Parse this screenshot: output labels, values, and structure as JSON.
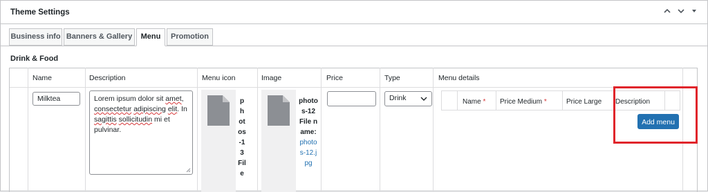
{
  "panel": {
    "title": "Theme Settings",
    "controls": [
      "chevron-up-icon",
      "chevron-down-icon",
      "caret-down-icon"
    ]
  },
  "tabs": [
    {
      "label": "Business info",
      "active": false
    },
    {
      "label": "Banners & Gallery",
      "active": false
    },
    {
      "label": "Menu",
      "active": true
    },
    {
      "label": "Promotion",
      "active": false
    }
  ],
  "section": {
    "title": "Drink & Food"
  },
  "columns": {
    "name": "Name",
    "description": "Description",
    "menu_icon": "Menu icon",
    "image": "Image",
    "price": "Price",
    "type": "Type",
    "menu_details": "Menu details"
  },
  "row": {
    "name_value": "Milktea",
    "description_value": {
      "w1": "Lorem ipsum dolor sit",
      "w2": "amet",
      "w3": ",",
      "w4": "consectetur",
      "w5": "adipiscing",
      "w6": "elit",
      "w7": ". In",
      "w8": "sagittis",
      "w9": "sollicitudin",
      "w10": "mi et",
      "w11": "pulvinar."
    },
    "icon_filename": "photos-13 File",
    "image_filename_prefix": "photos-12 File name:",
    "image_filename_link": "photos-12.jpg",
    "price_value": "",
    "type_value": "Drink"
  },
  "menu_details": {
    "headers": {
      "name": "Name",
      "price_medium": "Price Medium",
      "price_large": "Price Large",
      "description": "Description"
    },
    "required_mark": "*",
    "add_button": "Add menu"
  },
  "colors": {
    "accent": "#2271b1",
    "highlight": "#e0252b",
    "required": "#d63638"
  }
}
